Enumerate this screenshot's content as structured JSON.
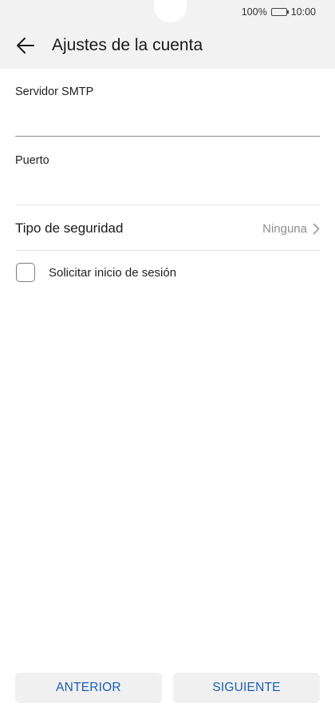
{
  "status_bar": {
    "battery_percent": "100%",
    "time": "10:00"
  },
  "app_bar": {
    "back_icon": "arrow-left-icon",
    "title": "Ajustes de la cuenta"
  },
  "form": {
    "smtp_server": {
      "label": "Servidor SMTP",
      "value": ""
    },
    "port": {
      "label": "Puerto",
      "value": ""
    },
    "security_type": {
      "label": "Tipo de seguridad",
      "value": "Ninguna",
      "icon": "chevron-right-icon"
    },
    "require_signin": {
      "label": "Solicitar inicio de sesión",
      "checked": false
    }
  },
  "footer": {
    "previous_label": "ANTERIOR",
    "next_label": "SIGUIENTE"
  },
  "colors": {
    "accent": "#1a5fb4",
    "header_bg": "#f2f2f2",
    "button_bg": "#f0f0f0",
    "secondary_text": "#8c8c8c"
  }
}
